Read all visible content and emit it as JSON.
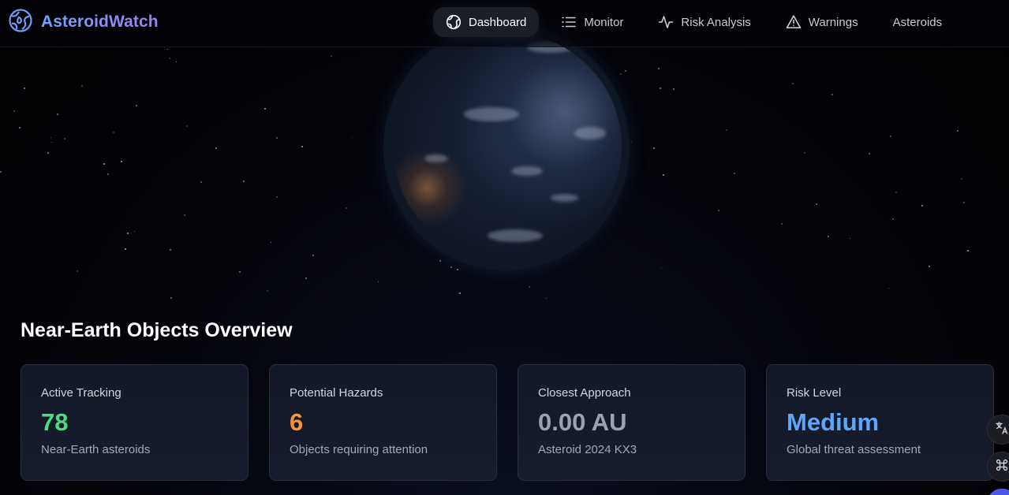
{
  "app": {
    "name": "AsteroidWatch"
  },
  "nav": {
    "items": [
      {
        "label": "Dashboard",
        "icon": "globe-icon",
        "active": true
      },
      {
        "label": "Monitor",
        "icon": "list-icon"
      },
      {
        "label": "Risk Analysis",
        "icon": "activity-icon"
      },
      {
        "label": "Warnings",
        "icon": "warning-icon"
      },
      {
        "label": "Asteroids"
      }
    ]
  },
  "overview": {
    "title": "Near-Earth Objects Overview",
    "cards": [
      {
        "label": "Active Tracking",
        "value": "78",
        "sub": "Near-Earth asteroids",
        "color": "#4ade80"
      },
      {
        "label": "Potential Hazards",
        "value": "6",
        "sub": "Objects requiring attention",
        "color": "#fb923c"
      },
      {
        "label": "Closest Approach",
        "value": "0.00 AU",
        "sub": "Asteroid 2024 KX3",
        "color": "#9ca3af"
      },
      {
        "label": "Risk Level",
        "value": "Medium",
        "sub": "Global threat assessment",
        "color": "#60a5fa"
      }
    ]
  },
  "colors": {
    "brand_start": "#6aa8ff",
    "brand_end": "#9f7df5",
    "background": "#020205"
  }
}
